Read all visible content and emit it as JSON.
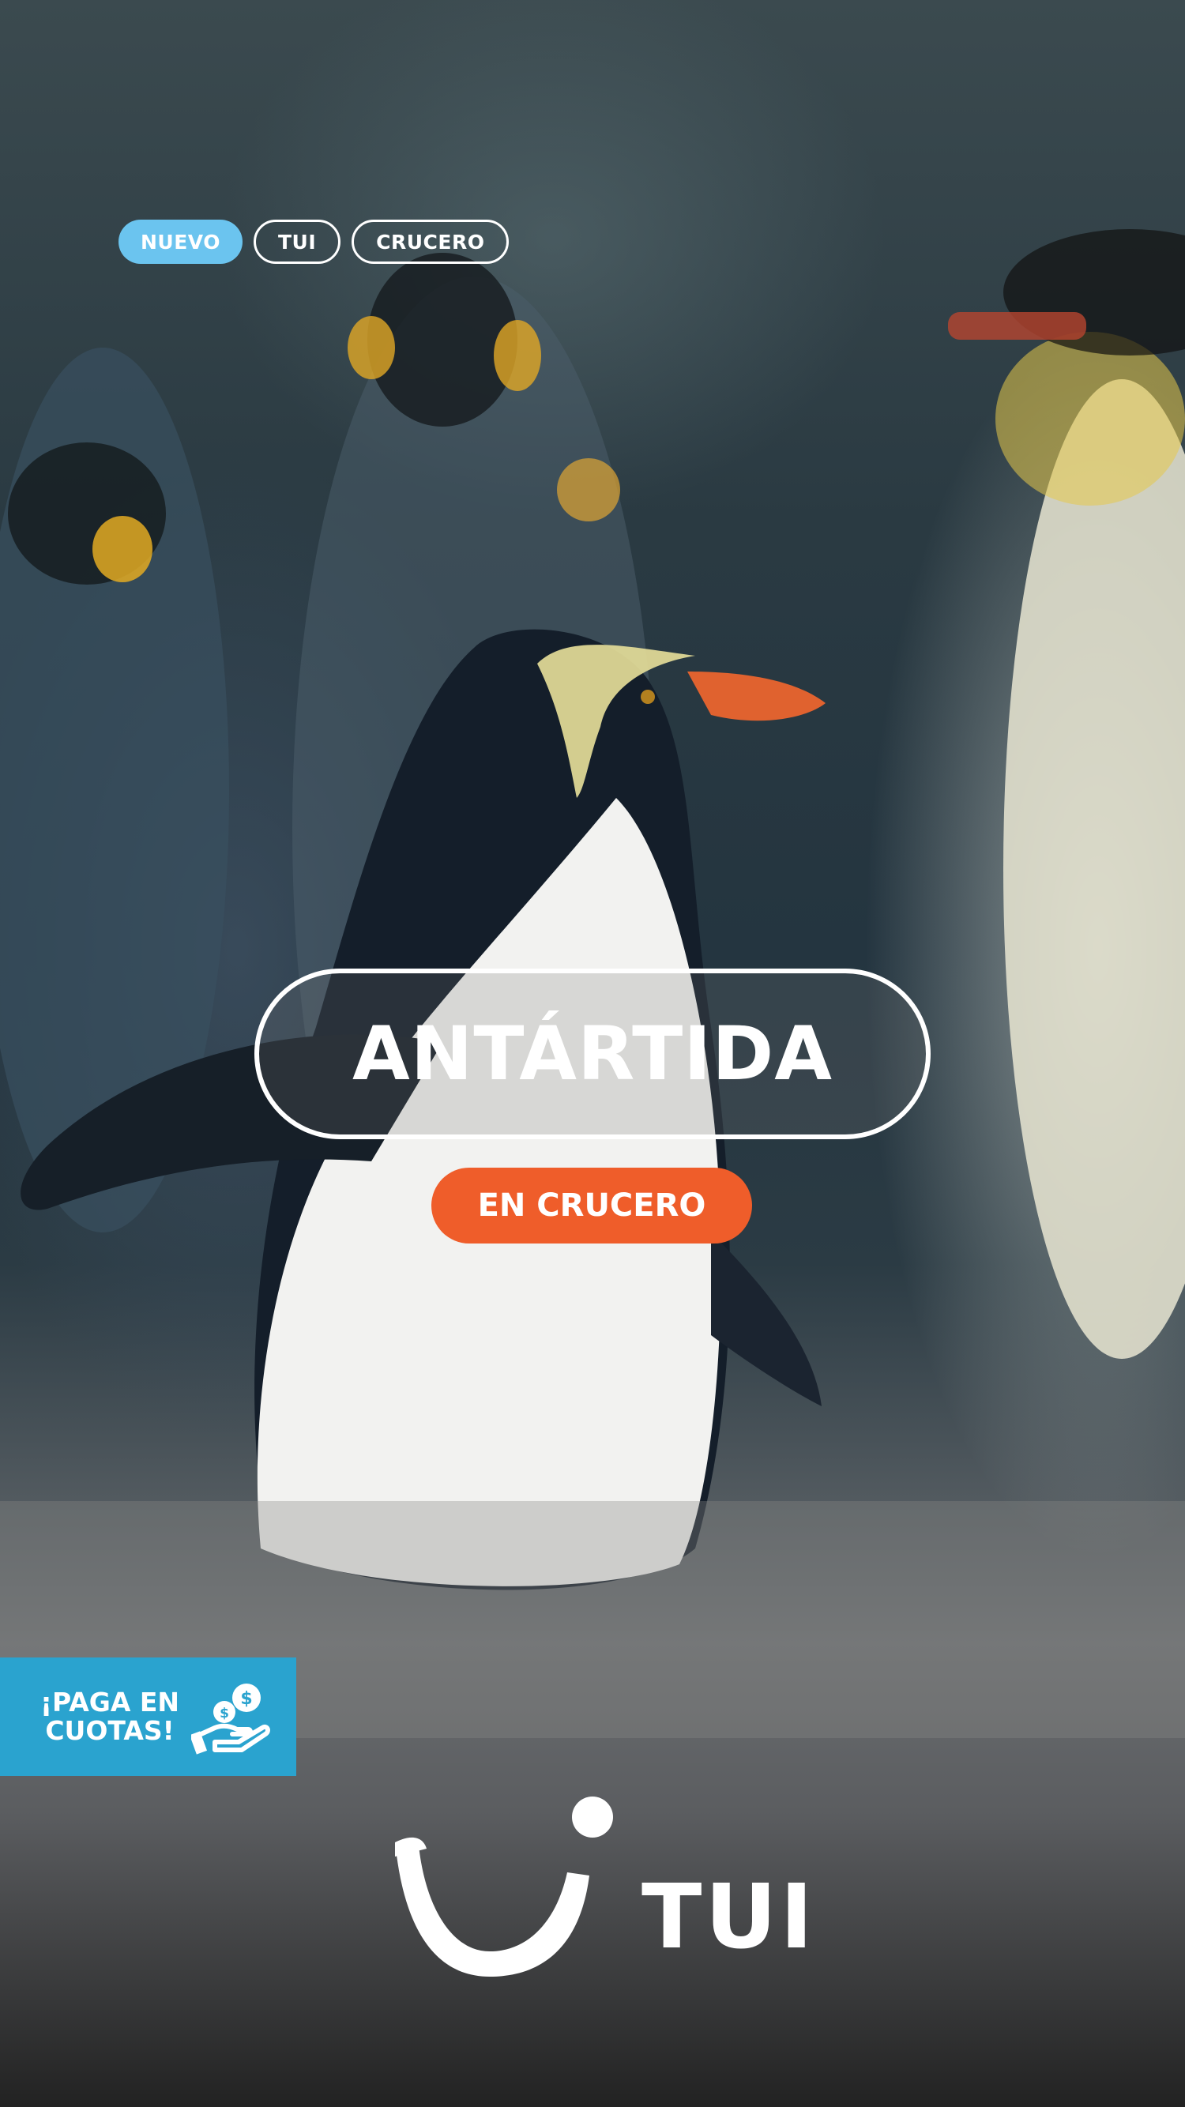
{
  "tags": [
    "NUEVO",
    "TUI",
    "CRUCERO"
  ],
  "hero": {
    "title": "ANTÁRTIDA",
    "cta_label": "EN CRUCERO"
  },
  "promo": {
    "line1": "¡PAGA EN",
    "line2": "CUOTAS!",
    "icon": "hand-coins-icon"
  },
  "brand": {
    "name": "TUI",
    "logo": "tui-smile-logo"
  },
  "colors": {
    "tag_accent": "#6bc4ef",
    "cta": "#ef5d2a",
    "promo_bg": "#2aa3cf"
  }
}
